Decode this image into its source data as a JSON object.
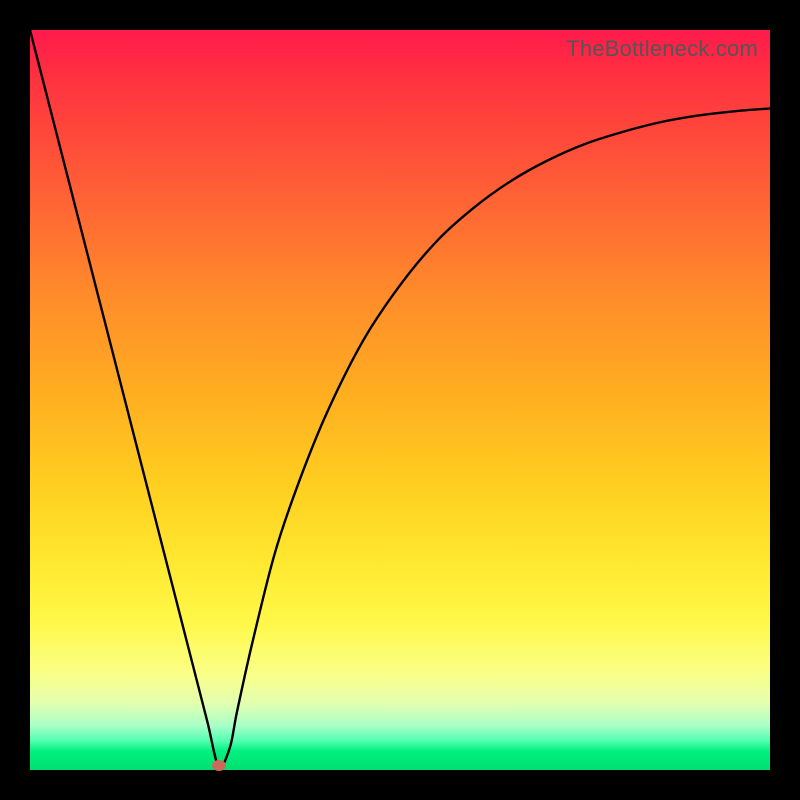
{
  "watermark": "TheBottleneck.com",
  "chart_data": {
    "type": "line",
    "title": "",
    "xlabel": "",
    "ylabel": "",
    "xlim": [
      0,
      100
    ],
    "ylim": [
      0,
      100
    ],
    "curve": {
      "name": "bottleneck-curve",
      "x": [
        0,
        5,
        10,
        15,
        20,
        22,
        24,
        25.5,
        27,
        28,
        30,
        33,
        36,
        40,
        45,
        50,
        55,
        60,
        65,
        70,
        75,
        80,
        85,
        90,
        95,
        100
      ],
      "y": [
        100,
        80.5,
        61,
        41.5,
        22,
        14.2,
        6.4,
        0.5,
        3,
        8,
        17,
        29,
        38,
        48,
        58,
        65.5,
        71.5,
        76,
        79.6,
        82.4,
        84.6,
        86.2,
        87.5,
        88.4,
        89,
        89.4
      ]
    },
    "marker": {
      "x": 25.5,
      "y": 0.5,
      "color": "#cc6a5a"
    },
    "gradient_stops": [
      {
        "pos": 0,
        "color": "#ff1a4c"
      },
      {
        "pos": 0.5,
        "color": "#ffd020"
      },
      {
        "pos": 0.88,
        "color": "#fbff88"
      },
      {
        "pos": 1.0,
        "color": "#00e070"
      }
    ]
  }
}
